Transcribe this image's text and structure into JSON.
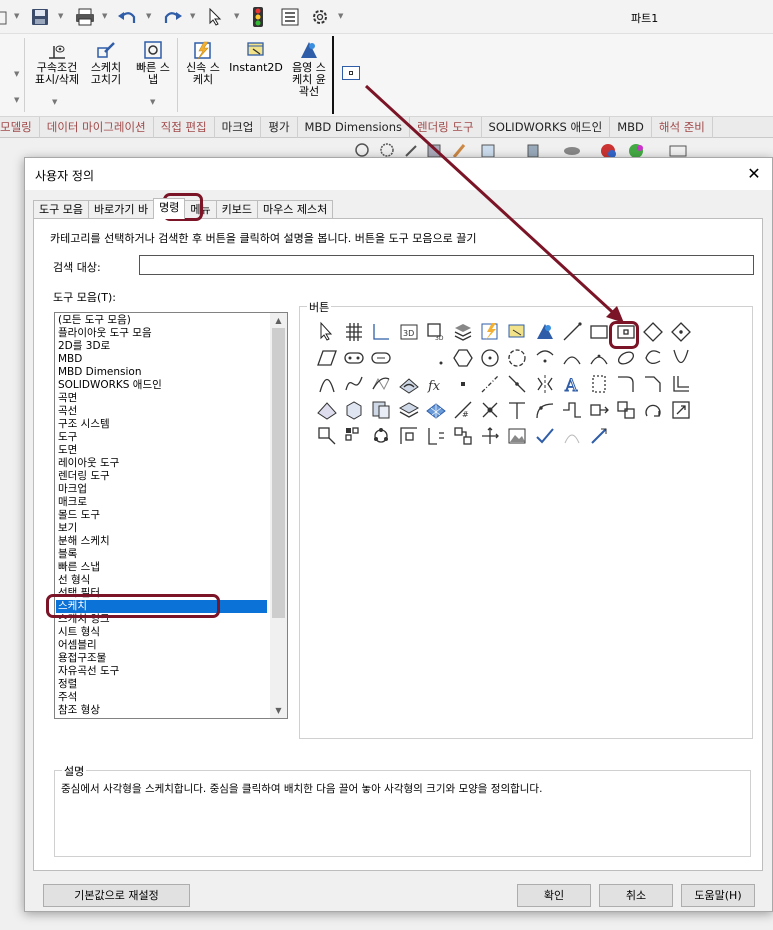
{
  "app_title": "파트1",
  "ribbon": {
    "buttons": [
      {
        "id": "show-relations",
        "label": "구속조건\n표시/삭제"
      },
      {
        "id": "repair-sketch",
        "label": "스케치\n고치기"
      },
      {
        "id": "quick-snaps",
        "label": "빠른 스\n냅"
      },
      {
        "id": "rapid-sketch",
        "label": "신속 스\n케치"
      },
      {
        "id": "instant2d",
        "label": "Instant2D"
      },
      {
        "id": "shaded-contours",
        "label": "음영 스\n케치 윤\n곽선"
      }
    ]
  },
  "command_tabs": [
    "모델링",
    "데이터 마이그레이션",
    "직접 편집",
    "마크업",
    "평가",
    "MBD Dimensions",
    "렌더링 도구",
    "SOLIDWORKS 애드인",
    "MBD",
    "해석 준비"
  ],
  "dialog": {
    "title": "사용자 정의",
    "tabs": [
      "도구 모음",
      "바로가기 바",
      "명령",
      "메뉴",
      "키보드",
      "마우스 제스처"
    ],
    "active_tab": "명령",
    "hint": "카테고리를 선택하거나 검색한 후 버튼을 클릭하여 설명을 봅니다. 버튼을 도구 모음으로 끌기",
    "search_label": "검색 대상:",
    "search_value": "",
    "toolbars_label": "도구 모음(T):",
    "toolbars": [
      "(모든 도구 모음)",
      "플라이아웃 도구 모음",
      "2D를 3D로",
      "MBD",
      "MBD Dimension",
      "SOLIDWORKS 애드인",
      "곡면",
      "곡선",
      "구조 시스템",
      "도구",
      "도면",
      "레이아웃 도구",
      "렌더링 도구",
      "마크업",
      "매크로",
      "몰드 도구",
      "보기",
      "분해 스케치",
      "블록",
      "빠른 스냅",
      "선 형식",
      "선택 필터",
      "스케치",
      "스케치 잉크",
      "시트 형식",
      "어셈블리",
      "용접구조물",
      "자유곡선 도구",
      "정렬",
      "주석",
      "참조 형상"
    ],
    "selected_toolbar": "스케치",
    "buttons_label": "버튼",
    "description_label": "설명",
    "description": "중심에서 사각형을 스케치합니다. 중심을 클릭하여 배치한 다음 끌어 놓아 사각형의 크기와 모양을 정의합니다.",
    "footer": {
      "reset": "기본값으로 재설정",
      "ok": "확인",
      "cancel": "취소",
      "help": "도움말(H)"
    }
  },
  "colors": {
    "highlight": "#7a1426",
    "selection": "#0b72d7",
    "ribbon_tab_text": "#a14a4a"
  }
}
